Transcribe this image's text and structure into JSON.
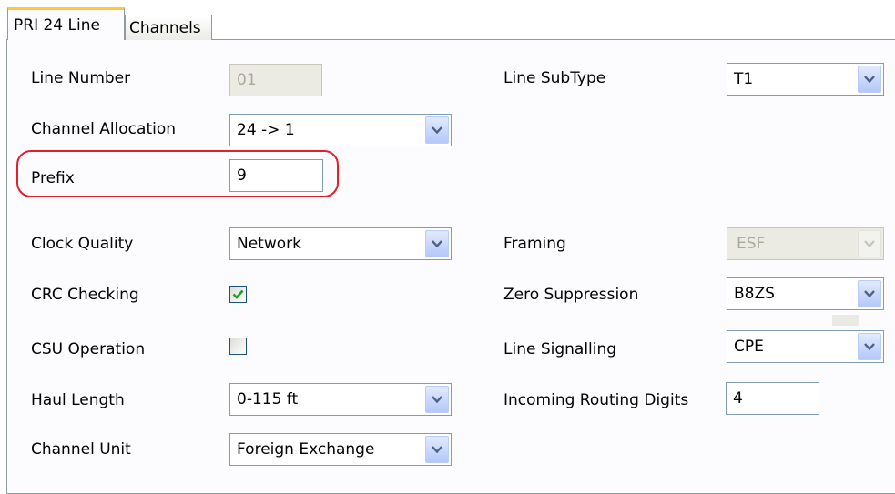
{
  "tabs": [
    {
      "label": "PRI 24 Line"
    },
    {
      "label": "Channels"
    }
  ],
  "form": {
    "line_number": {
      "label": "Line Number",
      "value": "01"
    },
    "channel_allocation": {
      "label": "Channel Allocation",
      "value": "24 -> 1"
    },
    "prefix": {
      "label": "Prefix",
      "value": "9"
    },
    "clock_quality": {
      "label": "Clock Quality",
      "value": "Network"
    },
    "crc_checking": {
      "label": "CRC Checking",
      "checked": true
    },
    "csu_operation": {
      "label": "CSU Operation",
      "checked": false
    },
    "haul_length": {
      "label": "Haul Length",
      "value": "0-115 ft"
    },
    "channel_unit": {
      "label": "Channel Unit",
      "value": "Foreign Exchange"
    },
    "line_subtype": {
      "label": "Line SubType",
      "value": "T1"
    },
    "framing": {
      "label": "Framing",
      "value": "ESF"
    },
    "zero_suppression": {
      "label": "Zero Suppression",
      "value": "B8ZS"
    },
    "line_signalling": {
      "label": "Line Signalling",
      "value": "CPE"
    },
    "incoming_routing_digits": {
      "label": "Incoming Routing Digits",
      "value": "4"
    }
  },
  "colors": {
    "highlight": "#e0202a",
    "tab_accent": "#ffc83c",
    "dropdown_arrow": "#4d6185"
  },
  "icons": {
    "dropdown": "chevron-down-icon",
    "check": "checkmark-icon"
  }
}
